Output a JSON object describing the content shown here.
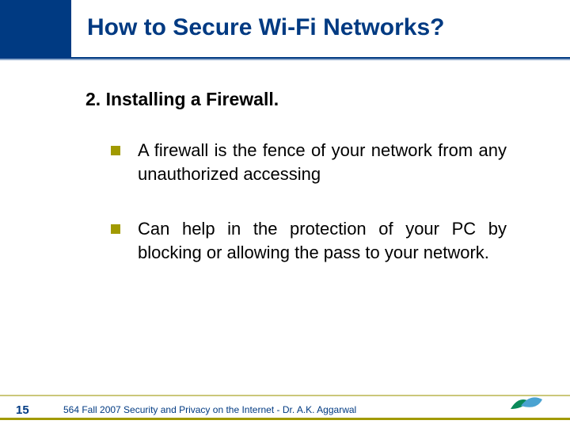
{
  "header": {
    "title": "How to Secure Wi-Fi Networks?"
  },
  "subtitle": "2.  Installing a Firewall.",
  "bullets": [
    "A firewall is the fence of your network from any unauthorized accessing",
    "Can help in the protection of your PC by blocking or allowing the pass to your network."
  ],
  "footer": {
    "page": "15",
    "text": "564  Fall 2007 Security and Privacy on the Internet - Dr. A.K. Aggarwal"
  },
  "colors": {
    "accent": "#003a82",
    "bullet": "#a19a00"
  }
}
